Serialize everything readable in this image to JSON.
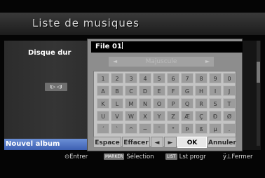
{
  "header": {
    "title": "Liste de musiques"
  },
  "left": {
    "disk_label": "Disque dur",
    "mini_button": "I▷ ◁I",
    "selected_item": "Nouvel album"
  },
  "dialog": {
    "name_value": "File 01",
    "case_mode": "Majuscule",
    "keyboard_rows": [
      [
        "1",
        "2",
        "3",
        "4",
        "5",
        "6",
        "7",
        "8",
        "9",
        "0"
      ],
      [
        "A",
        "B",
        "C",
        "D",
        "E",
        "F",
        "G",
        "H",
        "I",
        "J"
      ],
      [
        "K",
        "L",
        "M",
        "N",
        "O",
        "P",
        "Q",
        "R",
        "S",
        "T"
      ],
      [
        "U",
        "V",
        "W",
        "X",
        "Y",
        "Z",
        "Æ",
        "Ç",
        "Ð",
        "Ø"
      ],
      [
        "´",
        "`",
        "^",
        "~",
        "¨",
        "°",
        "Þ",
        "ß",
        "µ",
        "."
      ]
    ],
    "actions": {
      "space": "Espace",
      "erase": "Effacer",
      "left_arrow": "◄",
      "right_arrow": "►",
      "ok": "OK",
      "cancel": "Annuler"
    }
  },
  "footer": {
    "enter": "⊙Entrer",
    "marker_tag": "MARKER",
    "selection": "Sélection",
    "list_tag": "LIST",
    "list_label": "Lst progr",
    "close": "ÿ⊥Fermer"
  }
}
